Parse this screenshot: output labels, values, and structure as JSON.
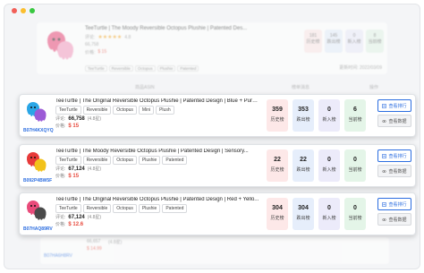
{
  "window": {
    "controls": [
      "close",
      "minimize",
      "maximize"
    ]
  },
  "background": {
    "title": "TeeTurtle | The Moody Reversible Octopus Plushie | Patented Des...",
    "rating_label": "评论:",
    "rating_value": "4.8",
    "reviews": "66,758",
    "price_label": "价格:",
    "price": "$ 15",
    "tags": [
      "TeeTurtle",
      "Reversible",
      "Octopus",
      "Plushie",
      "Patented"
    ],
    "stats": [
      {
        "value": "181",
        "label": "历史榜"
      },
      {
        "value": "145",
        "label": "跌出榜"
      },
      {
        "value": "0",
        "label": "新入榜"
      },
      {
        "value": "8",
        "label": "当前榜"
      }
    ],
    "update_label": "更新时间: 2022/03/09",
    "col_heads": [
      "商品ASIN",
      "榜单消息",
      "操作"
    ],
    "bottom_rating": "66,657",
    "bottom_rating_label": "(4.8星)",
    "bottom_price": "$ 14.99",
    "bottom_asin": "B07HA6H8RV"
  },
  "cards": [
    {
      "asin": "B07H4KXQYQ",
      "title": "TeeTurtle | The Original Reversible Octopus Plushie | Patented Design | Blue + Purp...",
      "tags": [
        "TeeTurtle",
        "Reversible",
        "Octopus",
        "Mini",
        "Plush"
      ],
      "rating_label": "评论:",
      "rating_count": "66,758",
      "rating_stars": "(4.8星)",
      "price_label": "价格:",
      "price": "$ 15",
      "stats": [
        {
          "value": "359",
          "label": "历史榜"
        },
        {
          "value": "353",
          "label": "跌出榜"
        },
        {
          "value": "0",
          "label": "新入榜"
        },
        {
          "value": "6",
          "label": "当前榜"
        }
      ],
      "btn_primary": "查看排行",
      "btn_secondary": "查看数据"
    },
    {
      "asin": "B092P4BW5F",
      "title": "TeeTurtle | The Moody Reversible Octopus Plushie | Patented Design | Sensory...",
      "tags": [
        "TeeTurtle",
        "Reversible",
        "Octopus",
        "Plushie",
        "Patented"
      ],
      "rating_label": "评论:",
      "rating_count": "67,124",
      "rating_stars": "(4.8星)",
      "price_label": "价格:",
      "price": "$ 15",
      "stats": [
        {
          "value": "22",
          "label": "历史榜"
        },
        {
          "value": "22",
          "label": "跌出榜"
        },
        {
          "value": "0",
          "label": "新入榜"
        },
        {
          "value": "0",
          "label": "当前榜"
        }
      ],
      "btn_primary": "查看排行",
      "btn_secondary": "查看数据"
    },
    {
      "asin": "B07HAQ89RV",
      "title": "TeeTurtle | The Original Reversible Octopus Plushie | Patented Design | Red + Yello...",
      "tags": [
        "TeeTurtle",
        "Reversible",
        "Octopus",
        "Plushie",
        "Patented"
      ],
      "rating_label": "评论:",
      "rating_count": "67,124",
      "rating_stars": "(4.8星)",
      "price_label": "价格:",
      "price": "$ 12.6",
      "stats": [
        {
          "value": "304",
          "label": "历史榜"
        },
        {
          "value": "304",
          "label": "跌出榜"
        },
        {
          "value": "0",
          "label": "新入榜"
        },
        {
          "value": "0",
          "label": "当前榜"
        }
      ],
      "btn_primary": "查看排行",
      "btn_secondary": "查看数据"
    }
  ],
  "colors": {
    "accent": "#2b6de0",
    "price": "#e84a3d"
  }
}
